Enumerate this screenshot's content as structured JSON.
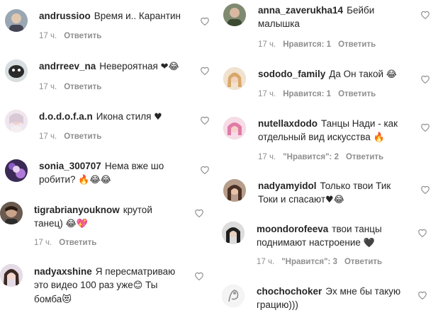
{
  "left": [
    {
      "user": "andrussioo",
      "text": "Время и.. Карантин",
      "emoji": "",
      "time": "17 ч.",
      "likes": "",
      "reply": "Ответить"
    },
    {
      "user": "andrreev_na",
      "text": "Невероятная ",
      "emoji": "❤😂",
      "time": "17 ч.",
      "likes": "",
      "reply": "Ответить"
    },
    {
      "user": "d.o.d.o.f.a.n",
      "text": "Икона стиля ",
      "emoji": "♥",
      "time": "17 ч.",
      "likes": "",
      "reply": "Ответить"
    },
    {
      "user": "sonia_300707",
      "text": "Нема вже шо робити? ",
      "emoji": "🔥😂😂",
      "time": "",
      "likes": "",
      "reply": ""
    },
    {
      "user": "tigrabrianyouknow",
      "text": "крутой танец) ",
      "emoji": "😂💖",
      "time": "17 ч.",
      "likes": "",
      "reply": "Ответить"
    },
    {
      "user": "nadyaxshine",
      "text": "Я пересматриваю это видео 100 раз уже",
      "emoji": "😊",
      "text2": " Ты бомба",
      "emoji2": "😻",
      "time": "",
      "likes": "",
      "reply": ""
    }
  ],
  "right": [
    {
      "user": "anna_zaverukha14",
      "text": "Бейби малышка",
      "emoji": "",
      "time": "17 ч.",
      "likes": "Нравится: 1",
      "reply": "Ответить"
    },
    {
      "user": "sododo_family",
      "text": "Да Он такой ",
      "emoji": "😂",
      "time": "17 ч.",
      "likes": "Нравится: 1",
      "reply": "Ответить"
    },
    {
      "user": "nutellaxdodo",
      "text": "Танцы Нади - как отдельный вид искусства ",
      "emoji": "🔥",
      "time": "17 ч.",
      "likes": "\"Нравится\": 2",
      "reply": "Ответить"
    },
    {
      "user": "nadyamyidol",
      "text": "Только твои Тик Токи и спасают",
      "emoji": "♥😂",
      "time": "",
      "likes": "",
      "reply": ""
    },
    {
      "user": "moondorofeeva",
      "text": "твои танцы поднимают настроение ",
      "emoji": "🖤",
      "time": "17 ч.",
      "likes": "\"Нравится\": 3",
      "reply": "Ответить"
    },
    {
      "user": "chochochoker",
      "text": "Эх мне бы такую грацию)))",
      "emoji": "",
      "time": "",
      "likes": "",
      "reply": ""
    }
  ],
  "colors": {
    "text": "#262626",
    "meta": "#8e8e8e",
    "heart_outline": "#8e8e8e"
  },
  "icons": {
    "like": "heart-outline-icon",
    "avatar": "avatar-image"
  }
}
